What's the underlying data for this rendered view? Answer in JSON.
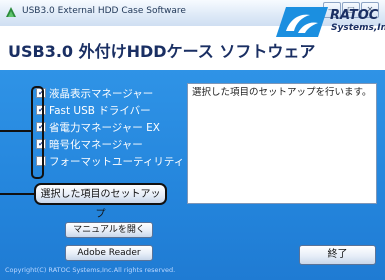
{
  "window": {
    "title": "USB3.0 External HDD Case Software",
    "controls": [
      "—",
      "□",
      "✕"
    ]
  },
  "header": {
    "title": "USB3.0 外付けHDDケース ソフトウェア",
    "logo_text": "RATOC",
    "logo_subtext": "Systems,Inc."
  },
  "checklist": {
    "items": [
      {
        "label": "液晶表示マネージャー",
        "checked": true
      },
      {
        "label": "Fast USB ドライバー",
        "checked": true
      },
      {
        "label": "省電力マネージャー EX",
        "checked": true
      },
      {
        "label": "暗号化マネージャー",
        "checked": true
      },
      {
        "label": "フォーマットユーティリティ",
        "checked": false
      }
    ]
  },
  "description": {
    "text": "選択した項目のセットアップを行います。"
  },
  "buttons": {
    "setup": "選択した項目のセットアップ",
    "manual": "マニュアルを開く",
    "adobe": "Adobe Reader",
    "exit": "終了"
  },
  "footer": {
    "copyright": "Copyright(C) RATOC Systems,Inc.All rights reserved."
  },
  "colors": {
    "panel": "#2485dc",
    "header_text": "#1a2f63",
    "logo_accent": "#1b8fe0"
  }
}
